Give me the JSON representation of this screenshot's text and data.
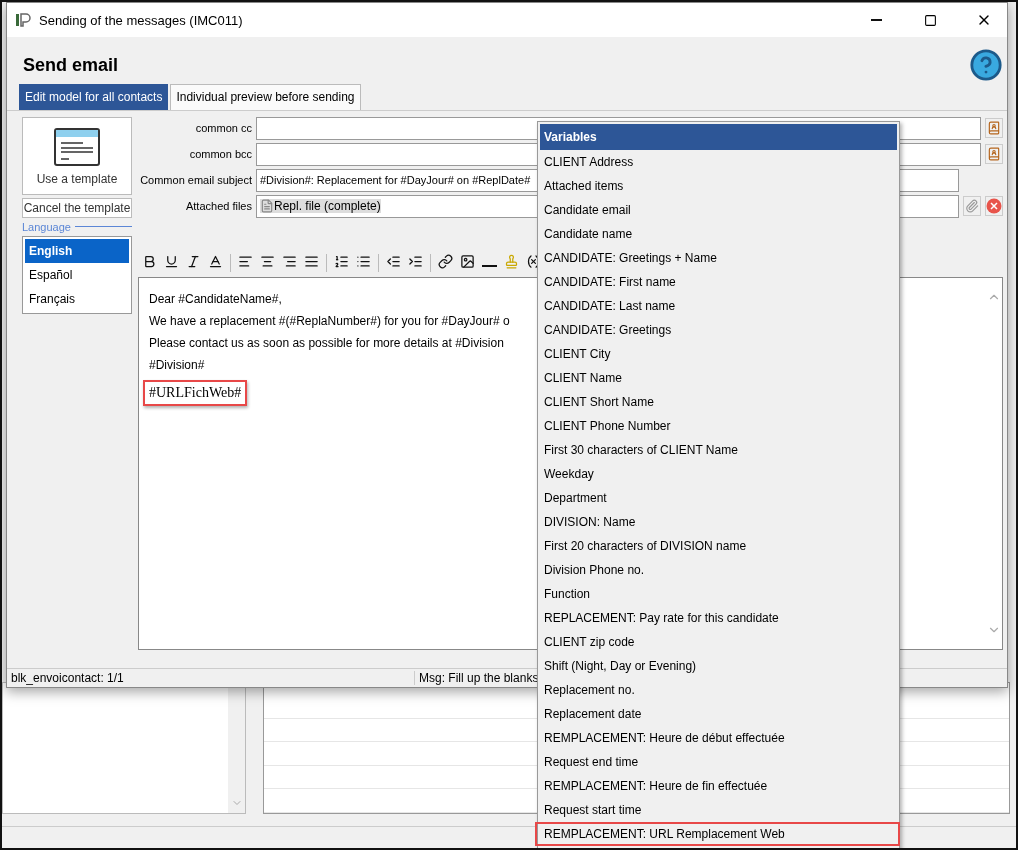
{
  "window": {
    "title": "Sending of the messages (IMC011)"
  },
  "heading": "Send email",
  "tabs": [
    {
      "label": "Edit model for all contacts",
      "selected": true
    },
    {
      "label": "Individual preview before sending",
      "selected": false
    }
  ],
  "template_button": "Use a template",
  "cancel_template_button": "Cancel the template",
  "language": {
    "legend": "Language",
    "items": [
      {
        "label": "English",
        "selected": true
      },
      {
        "label": "Español",
        "selected": false
      },
      {
        "label": "Français",
        "selected": false
      }
    ]
  },
  "form": [
    {
      "label": "common cc",
      "kind": "address"
    },
    {
      "label": "common bcc",
      "kind": "address"
    },
    {
      "label": "Common email subject",
      "value": "#Division#: Replacement for #DayJour# on #ReplDate#",
      "kind": "text"
    },
    {
      "label": "Attached files",
      "value": "Repl. file (complete)",
      "kind": "file"
    }
  ],
  "editor": {
    "lines": [
      {
        "text": "Dear #CandidateName#,",
        "highlighted": false
      },
      {
        "text": "We have a replacement #(#ReplaNumber#) for you for #DayJour# o",
        "highlighted": false
      },
      {
        "text": "Please contact us as soon as possible for more details at #Division",
        "highlighted": false
      },
      {
        "text": "#Division#",
        "highlighted": false
      },
      {
        "text": "#URLFichWeb#",
        "highlighted": true
      }
    ]
  },
  "status_bar": {
    "record": "blk_envoicontact: 1/1",
    "message": "Msg: Fill up the blanks"
  },
  "variables_menu": {
    "title": "Variables",
    "items": [
      {
        "label": "CLIENT Address",
        "highlighted": false
      },
      {
        "label": "Attached items",
        "highlighted": false
      },
      {
        "label": "Candidate email",
        "highlighted": false
      },
      {
        "label": "Candidate name",
        "highlighted": false
      },
      {
        "label": "CANDIDATE: Greetings + Name",
        "highlighted": false
      },
      {
        "label": "CANDIDATE: First name",
        "highlighted": false
      },
      {
        "label": "CANDIDATE: Last name",
        "highlighted": false
      },
      {
        "label": "CANDIDATE: Greetings",
        "highlighted": false
      },
      {
        "label": "CLIENT City",
        "highlighted": false
      },
      {
        "label": "CLIENT Name",
        "highlighted": false
      },
      {
        "label": "CLIENT Short Name",
        "highlighted": false
      },
      {
        "label": "CLIENT Phone Number",
        "highlighted": false
      },
      {
        "label": "First 30 characters of CLIENT Name",
        "highlighted": false
      },
      {
        "label": "Weekday",
        "highlighted": false
      },
      {
        "label": "Department",
        "highlighted": false
      },
      {
        "label": "DIVISION: Name",
        "highlighted": false
      },
      {
        "label": "First 20 characters of DIVISION name",
        "highlighted": false
      },
      {
        "label": "Division Phone no.",
        "highlighted": false
      },
      {
        "label": "Function",
        "highlighted": false
      },
      {
        "label": "REPLACEMENT: Pay rate for this candidate",
        "highlighted": false
      },
      {
        "label": "CLIENT zip code",
        "highlighted": false
      },
      {
        "label": "Shift (Night, Day or Evening)",
        "highlighted": false
      },
      {
        "label": "Replacement no.",
        "highlighted": false
      },
      {
        "label": "Replacement date",
        "highlighted": false
      },
      {
        "label": "REMPLACEMENT: Heure de début effectuée",
        "highlighted": false
      },
      {
        "label": "Request end time",
        "highlighted": false
      },
      {
        "label": "REMPLACEMENT: Heure de fin effectuée",
        "highlighted": false
      },
      {
        "label": "Request start time",
        "highlighted": false
      },
      {
        "label": "REMPLACEMENT: URL Remplacement Web",
        "highlighted": true
      }
    ]
  }
}
